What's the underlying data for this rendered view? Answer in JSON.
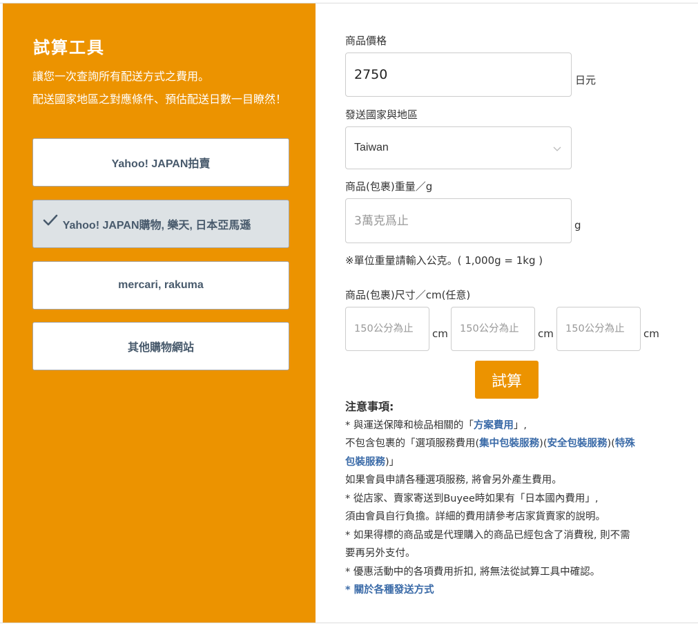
{
  "left": {
    "title": "試算工具",
    "desc1": "讓您一次查詢所有配送方式之費用。",
    "desc2": "配送國家地區之對應條件、預估配送日數一目瞭然！",
    "sites": [
      {
        "label": "Yahoo! JAPAN拍賣",
        "selected": false
      },
      {
        "label": "Yahoo! JAPAN購物, 樂天, 日本亞馬遜",
        "selected": true
      },
      {
        "label": "mercari, rakuma",
        "selected": false
      },
      {
        "label": "其他購物網站",
        "selected": false
      }
    ]
  },
  "form": {
    "price_label": "商品價格",
    "price_value": "2750",
    "price_unit": "日元",
    "country_label": "發送國家與地區",
    "country_value": "Taiwan",
    "weight_label": "商品(包裹)重量／g",
    "weight_placeholder": "3萬克爲止",
    "weight_unit": "g",
    "weight_note": "※單位重量請輸入公克。( 1,000g = 1kg )",
    "size_label": "商品(包裹)尺寸／cm(任意)",
    "size_placeholder": "150公分為止",
    "size_unit": "cm",
    "calc_button": "試算"
  },
  "notes": {
    "title": "注意事項:",
    "l1a": "* 與運送保障和檢品相關的「",
    "l1link": "方案費用",
    "l1b": "」,",
    "l2a": "不包含包裹的「選項服務費用(",
    "l2link1": "集中包裝服務",
    "l2mid1": ")(",
    "l2link2": "安全包裝服務",
    "l2mid2": ")(",
    "l2link3a": "特殊",
    "l3link": "包裝服務",
    "l3b": ")」",
    "l4": "如果會員申請各種選項服務, 將會另外產生費用。",
    "l5": "* 從店家、賣家寄送到Buyee時如果有「日本國內費用」,",
    "l6": "須由會員自行負擔。詳細的費用請參考店家貨賣家的說明。",
    "l7": "* 如果得標的商品或是代理購入的商品已經包含了消費稅, 則不需",
    "l8": "要再另外支付。",
    "l9": "* 優惠活動中的各項費用折扣, 將無法從試算工具中確認。",
    "l10": "* 關於各種發送方式"
  },
  "colors": {
    "accent": "#ec9300",
    "link": "#3b6ba8",
    "selected_bg": "#dde2e5"
  }
}
